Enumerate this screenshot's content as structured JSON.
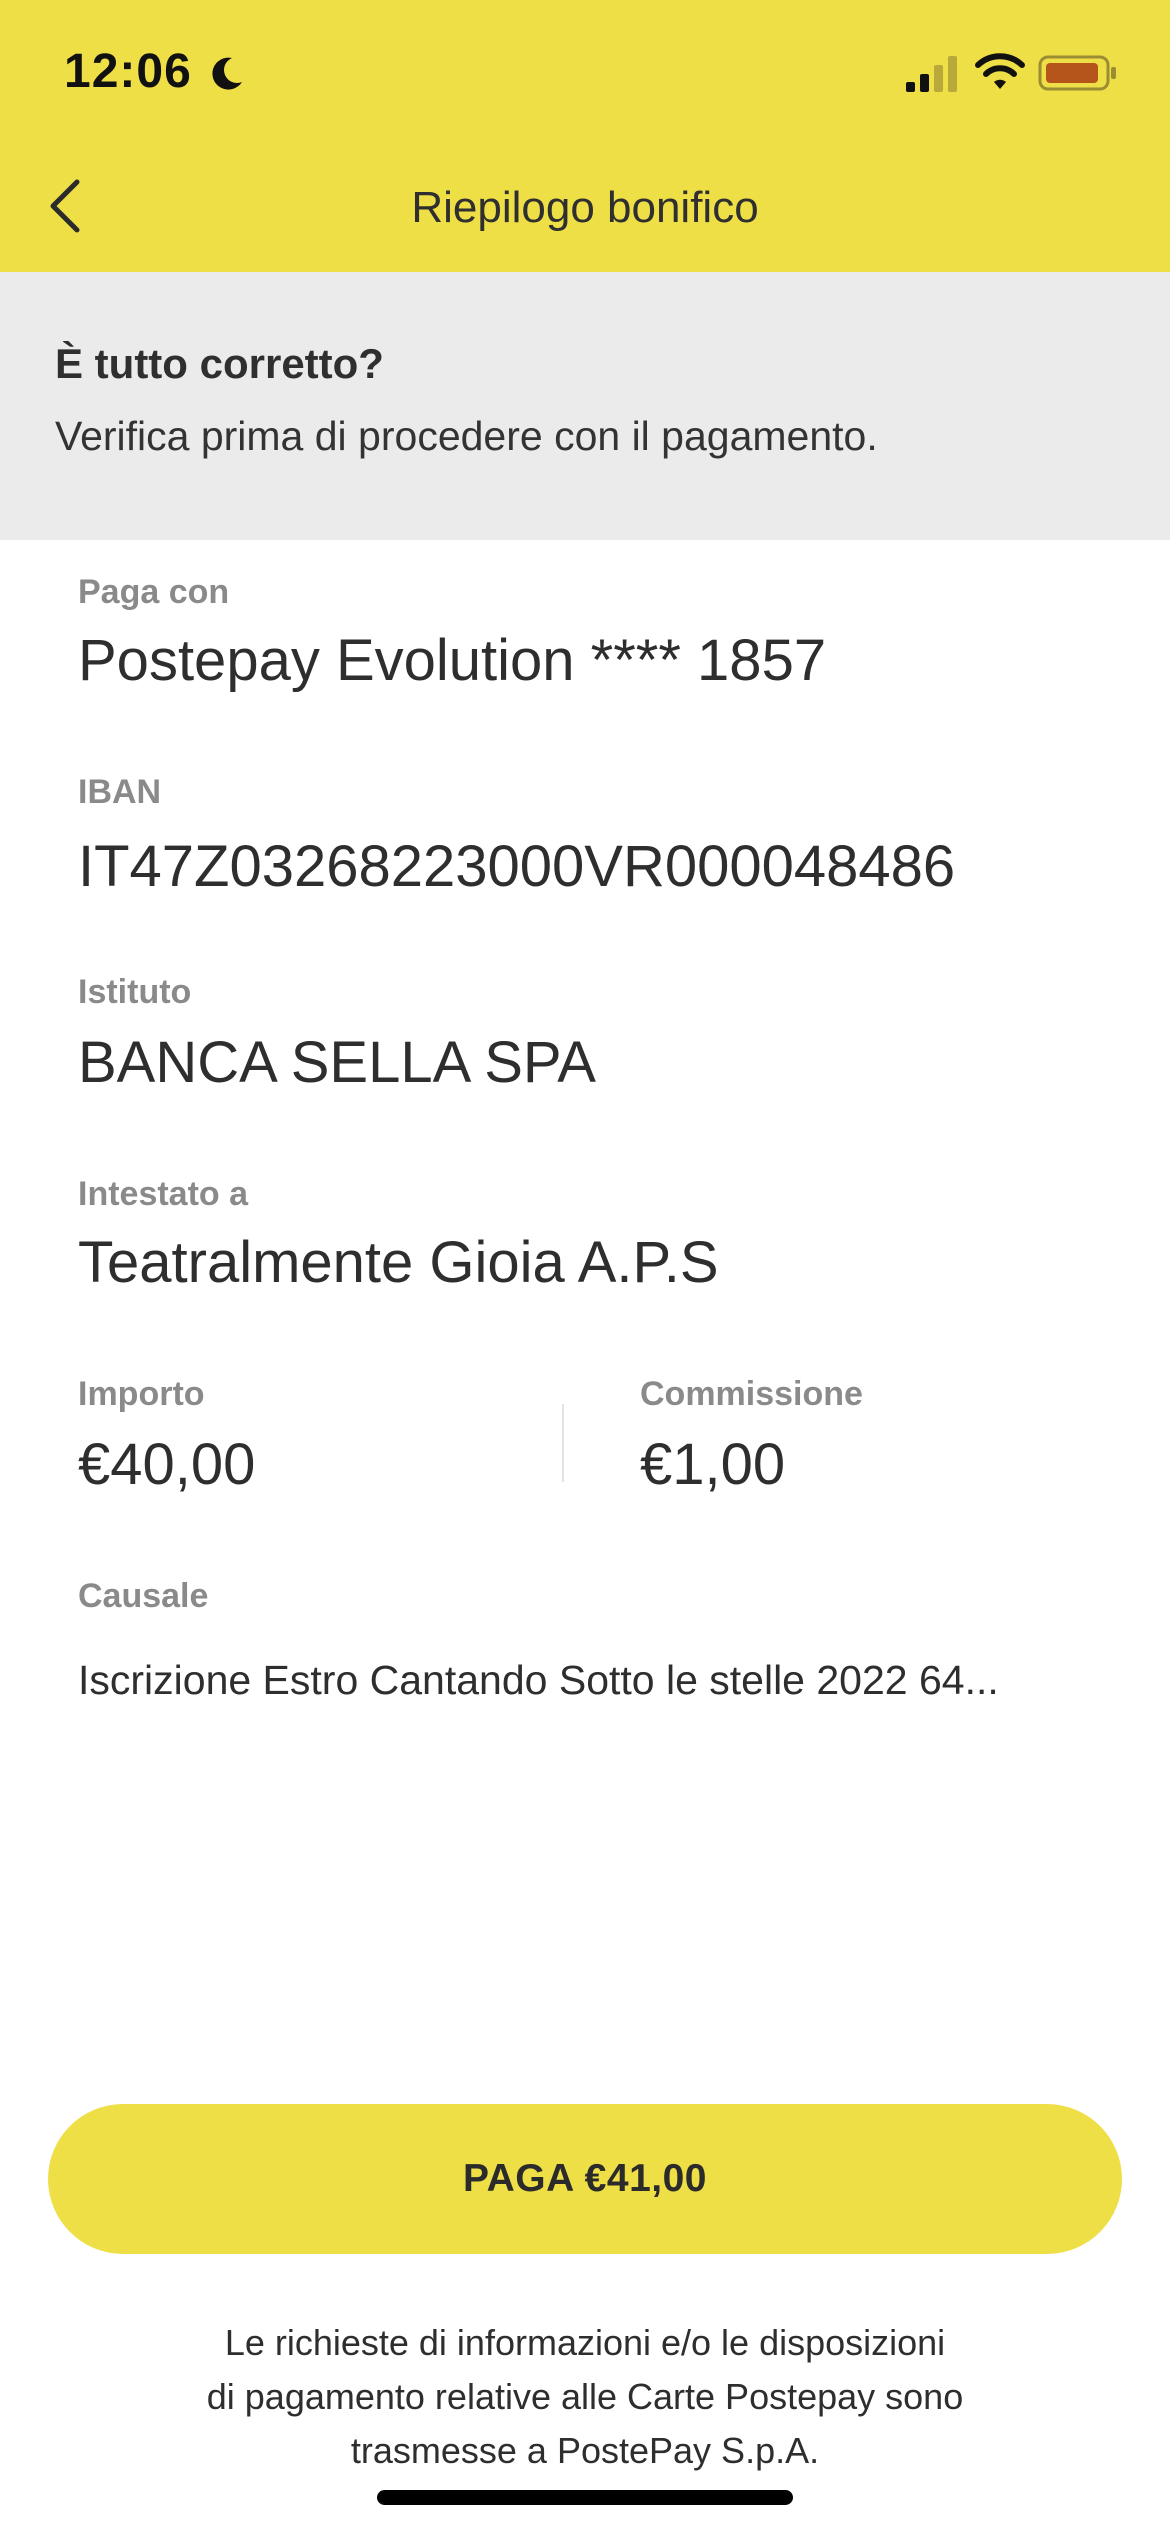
{
  "status_bar": {
    "time": "12:06"
  },
  "header": {
    "title": "Riepilogo bonifico"
  },
  "info": {
    "title": "È tutto corretto?",
    "subtitle": "Verifica prima di procedere con il pagamento."
  },
  "fields": {
    "pay_with": {
      "label": "Paga con",
      "value": "Postepay Evolution **** 1857"
    },
    "iban": {
      "label": "IBAN",
      "value": "IT47Z03268223000VR000048486"
    },
    "institute": {
      "label": "Istituto",
      "value": "BANCA SELLA SPA"
    },
    "holder": {
      "label": "Intestato a",
      "value": "Teatralmente Gioia A.P.S"
    },
    "amount": {
      "label": "Importo",
      "value": "€40,00"
    },
    "fee": {
      "label": "Commissione",
      "value": "€1,00"
    },
    "reason": {
      "label": "Causale",
      "value": "Iscrizione Estro Cantando Sotto le stelle 2022 64..."
    }
  },
  "pay_button": {
    "label": "PAGA €41,00"
  },
  "disclaimer": {
    "line1": "Le richieste di informazioni e/o le disposizioni",
    "line2": "di pagamento relative alle Carte Postepay sono",
    "line3": "trasmesse a PostePay S.p.A."
  },
  "colors": {
    "brand_yellow": "#EFDF47",
    "info_background": "#EBEBEB",
    "label_gray": "#8A8A8A",
    "battery_fill": "#B5541B"
  },
  "icons": {
    "moon": "moon-icon",
    "signal": "signal-icon",
    "wifi": "wifi-icon",
    "battery": "battery-icon",
    "back": "chevron-left-icon"
  }
}
